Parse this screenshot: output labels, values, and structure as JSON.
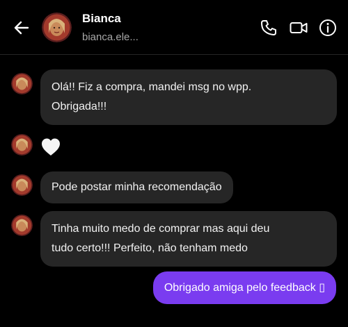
{
  "contact": {
    "name": "Bianca",
    "handle": "bianca.ele..."
  },
  "header_icons": [
    "back-arrow-icon",
    "phone-icon",
    "video-camera-icon",
    "info-icon"
  ],
  "messages": [
    {
      "from": "Bianca",
      "lines": [
        "Olá!! Fiz a compra, mandei msg no wpp.",
        "Obrigada!!!"
      ]
    },
    {
      "from": "Bianca",
      "reaction": "white-heart"
    },
    {
      "from": "Bianca",
      "text": "Pode postar minha recomendação"
    },
    {
      "from": "Bianca",
      "lines": [
        "Tinha muito medo de comprar mas aqui deu",
        "tudo certo!!! Perfeito, não tenham medo"
      ]
    },
    {
      "from": "me",
      "text": "Obrigado amiga pelo feedback ▯"
    }
  ],
  "colors": {
    "background": "#000000",
    "incoming_bubble": "#262626",
    "outgoing_bubble": "#7a3cf0",
    "secondary_text": "#a8a8a8"
  }
}
